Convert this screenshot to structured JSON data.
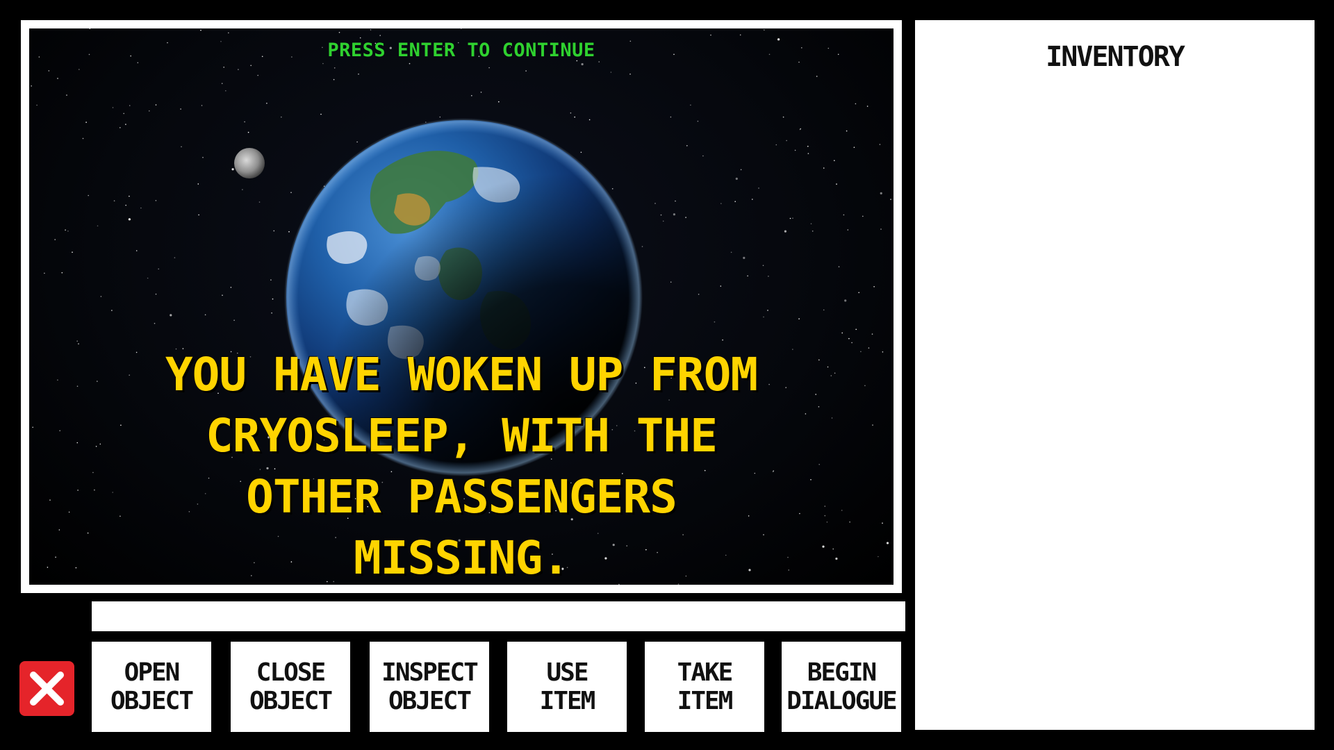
{
  "scene": {
    "prompt": "PRESS ENTER TO CONTINUE",
    "narration": "You have woken up from cryosleep, with the other passengers missing.",
    "image": "earth-from-space"
  },
  "command_line": {
    "value": ""
  },
  "close_button": {
    "icon": "close-icon",
    "color": "#e5242a"
  },
  "verbs": [
    {
      "id": "open",
      "label": "OPEN\nOBJECT"
    },
    {
      "id": "close",
      "label": "CLOSE\nOBJECT"
    },
    {
      "id": "inspect",
      "label": "INSPECT\nOBJECT"
    },
    {
      "id": "use",
      "label": "USE\nITEM"
    },
    {
      "id": "take",
      "label": "TAKE\nITEM"
    },
    {
      "id": "dialogue",
      "label": "BEGIN\nDIALOGUE"
    }
  ],
  "inventory": {
    "title": "INVENTORY",
    "items": []
  },
  "colors": {
    "prompt": "#2fd12f",
    "narration": "#ffd400"
  }
}
